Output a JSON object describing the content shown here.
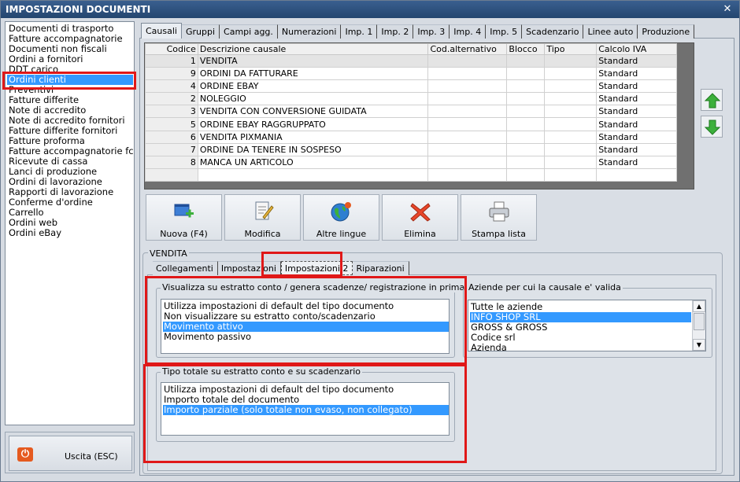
{
  "window": {
    "title": "IMPOSTAZIONI DOCUMENTI",
    "close_icon": "✕"
  },
  "doc_list": {
    "items": [
      "Documenti di trasporto",
      "Fatture accompagnatorie",
      "Documenti non fiscali",
      "Ordini a fornitori",
      "DDT carico",
      "Ordini clienti",
      "Preventivi",
      "Fatture differite",
      "Note di accredito",
      "Note di accredito fornitori",
      "Fatture differite fornitori",
      "Fatture proforma",
      "Fatture accompagnatorie fc",
      "Ricevute di cassa",
      "Lanci di produzione",
      "Ordini di lavorazione",
      "Rapporti di lavorazione",
      "Conferme d'ordine",
      "Carrello",
      "Ordini web",
      "Ordini eBay"
    ],
    "selected": "Ordini clienti"
  },
  "exit": {
    "label": "Uscita (ESC)"
  },
  "main_tabs": [
    "Causali",
    "Gruppi",
    "Campi agg.",
    "Numerazioni",
    "Imp. 1",
    "Imp. 2",
    "Imp. 3",
    "Imp. 4",
    "Imp. 5",
    "Scadenzario",
    "Linee auto",
    "Produzione"
  ],
  "main_tab_active": "Causali",
  "grid": {
    "columns": [
      "Codice",
      "Descrizione causale",
      "Cod.alternativo",
      "Blocco",
      "Tipo",
      "Calcolo IVA"
    ],
    "rows": [
      [
        "1",
        "VENDITA",
        "",
        "",
        "",
        "Standard"
      ],
      [
        "9",
        "ORDINI DA FATTURARE",
        "",
        "",
        "",
        "Standard"
      ],
      [
        "4",
        "ORDINE EBAY",
        "",
        "",
        "",
        "Standard"
      ],
      [
        "2",
        "NOLEGGIO",
        "",
        "",
        "",
        "Standard"
      ],
      [
        "3",
        "VENDITA CON CONVERSIONE GUIDATA",
        "",
        "",
        "",
        "Standard"
      ],
      [
        "5",
        "ORDINE EBAY RAGGRUPPATO",
        "",
        "",
        "",
        "Standard"
      ],
      [
        "6",
        "VENDITA PIXMANIA",
        "",
        "",
        "",
        "Standard"
      ],
      [
        "7",
        "ORDINE DA TENERE IN SOSPESO",
        "",
        "",
        "",
        "Standard"
      ],
      [
        "8",
        "MANCA UN ARTICOLO",
        "",
        "",
        "",
        "Standard"
      ]
    ]
  },
  "toolbar": {
    "new_label": "Nuova (F4)",
    "edit_label": "Modifica",
    "languages_label": "Altre lingue",
    "delete_label": "Elimina",
    "print_label": "Stampa lista"
  },
  "section": {
    "title": "VENDITA",
    "sub_tabs": [
      "Collegamenti",
      "Impostazioni",
      "Impostazioni 2",
      "Riparazioni"
    ],
    "sub_tab_active": "Impostazioni 2"
  },
  "display_group": {
    "title": "Visualizza su estratto conto / genera scadenze/ registrazione  in prima nota",
    "options": [
      "Utilizza impostazioni di default del tipo documento",
      "Non visualizzare su estratto conto/scadenzario",
      "Movimento attivo",
      "Movimento passivo"
    ],
    "selected": "Movimento attivo"
  },
  "total_group": {
    "title": "Tipo totale su estratto conto e su scadenzario",
    "options": [
      "Utilizza impostazioni di default del tipo documento",
      "Importo totale del documento",
      "Importo parziale (solo totale non evaso, non collegato)"
    ],
    "selected": "Importo parziale (solo totale non evaso, non collegato)"
  },
  "companies_group": {
    "title": "Aziende per cui la causale e' valida",
    "options": [
      "Tutte le aziende",
      "INFO SHOP SRL",
      "GROSS & GROSS",
      "Codice srl",
      "Azienda"
    ],
    "selected": "INFO SHOP SRL"
  },
  "colors": {
    "selection": "#3399ff",
    "highlight_box": "#e01818",
    "title_bar": "#2b4f7c"
  }
}
